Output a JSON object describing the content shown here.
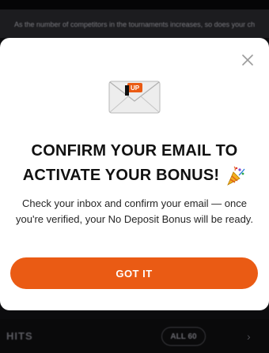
{
  "background": {
    "top_banner_text": "As the number of competitors in the tournaments increases, so does your ch",
    "bottom_section_label": "HITS",
    "all_pill_label": "ALL 60",
    "next_arrow": "›"
  },
  "modal": {
    "close_icon": "close-icon",
    "envelope_icon": "envelope-icon",
    "envelope_logo": "UP",
    "title_line1": "CONFIRM YOUR EMAIL TO",
    "title_line2": "ACTIVATE YOUR BONUS!",
    "title_emoji_icon": "party-popper-icon",
    "body": "Check your inbox and confirm your email — once you're verified, your No Deposit Bonus will be ready.",
    "button_label": "GOT IT"
  },
  "colors": {
    "accent": "#ea5b14",
    "modal_background": "#ffffff",
    "page_background": "#0c0c0e"
  }
}
